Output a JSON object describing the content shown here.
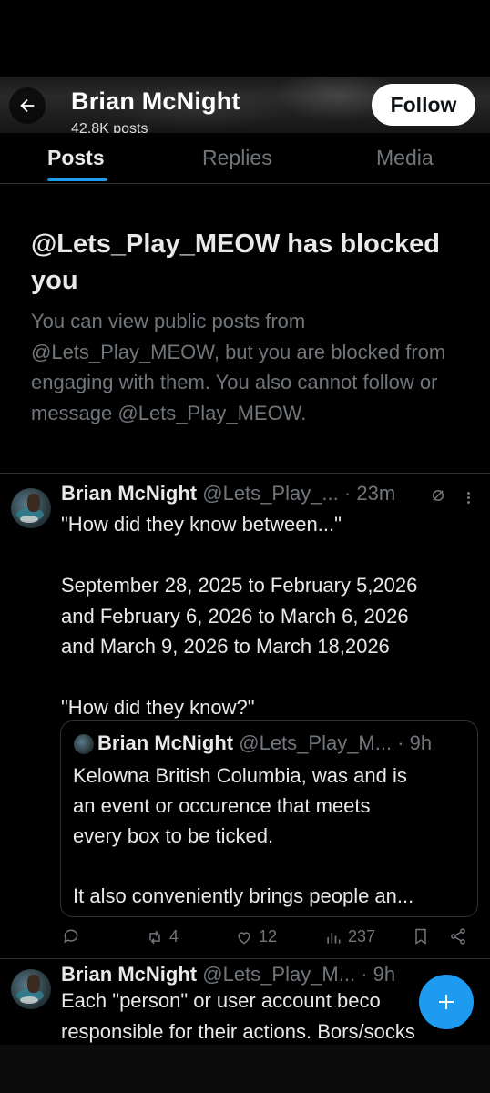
{
  "header": {
    "profile_name": "Brian McNight",
    "followers_partial": "42.8K posts",
    "follow_label": "Follow"
  },
  "tabs": [
    {
      "label": "Posts",
      "active": true
    },
    {
      "label": "Replies",
      "active": false
    },
    {
      "label": "Media",
      "active": false
    }
  ],
  "blocked_notice": {
    "title": "@Lets_Play_MEOW has blocked you",
    "description": "You can view public posts from @Lets_Play_MEOW, but you are blocked from engaging with them. You also cannot follow or message @Lets_Play_MEOW."
  },
  "tweets": [
    {
      "name": "Brian McNight",
      "handle": "@Lets_Play_...",
      "time": "· 23m",
      "body": "\"How did they know between...\"\n\nSeptember 28, 2025 to February 5,2026\nand February 6, 2026 to March 6, 2026\nand March 9, 2026 to March 18,2026\n\n\"How did they know?\"",
      "quote": {
        "name": "Brian McNight",
        "handle": "@Lets_Play_M...",
        "time": "· 9h",
        "body": "Kelowna British Columbia, was and is\nan event or occurence that meets\nevery box to be ticked.\n\nIt also conveniently brings people an..."
      },
      "stats": {
        "retweets": "4",
        "likes": "12",
        "views": "237"
      }
    },
    {
      "name": "Brian McNight",
      "handle": "@Lets_Play_M...",
      "time": "· 9h",
      "body": "Each \"person\" or user account beco\nresponsible for their actions. Bors/socks"
    }
  ],
  "colors": {
    "background": "#000000",
    "text_primary": "#e7e9ea",
    "text_secondary": "#71767b",
    "accent": "#1d9bf0",
    "divider": "#2f3336"
  }
}
